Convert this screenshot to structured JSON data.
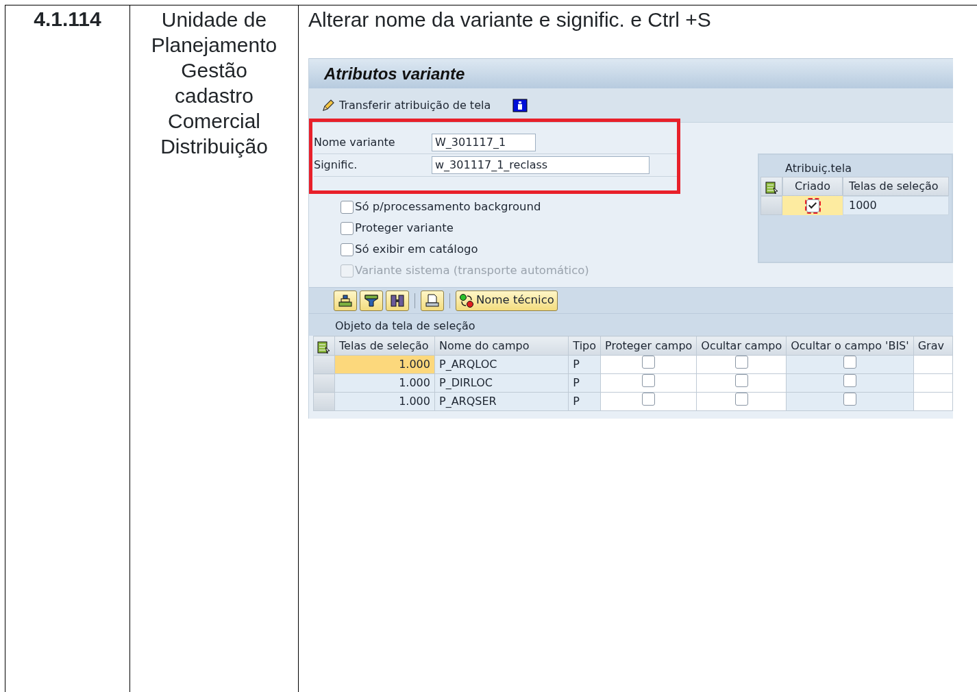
{
  "step": {
    "number": "4.1.114",
    "area": "Unidade de\nPlanejamento\nGestão\ncadastro\nComercial\nDistribuição",
    "instruction": "Alterar nome da variante e signific. e Ctrl +S"
  },
  "sap": {
    "title": "Atributos variante",
    "toolbar": {
      "label": "Transferir atribuição de tela"
    },
    "fields": [
      {
        "label": "Nome variante",
        "value": "W_301117_1"
      },
      {
        "label": "Signific.",
        "value": "w_301117_1_reclass"
      }
    ],
    "options": [
      {
        "label": "Só p/processamento background",
        "checked": false,
        "disabled": false
      },
      {
        "label": "Proteger variante",
        "checked": false,
        "disabled": false
      },
      {
        "label": "Só exibir em catálogo",
        "checked": false,
        "disabled": false
      },
      {
        "label": "Variante sistema (transporte automático)",
        "checked": false,
        "disabled": true
      }
    ],
    "assignment": {
      "title": "Atribuiç.tela",
      "columns": [
        "Criado",
        "Telas de seleção"
      ],
      "rows": [
        {
          "created": true,
          "screen": "1000",
          "selected": true
        }
      ]
    },
    "grid_toolbar": {
      "tech_button": "Nome técnico"
    },
    "section_title": "Objeto da tela de seleção",
    "table": {
      "columns": [
        "Telas de seleção",
        "Nome do campo",
        "Tipo",
        "Proteger campo",
        "Ocultar campo",
        "Ocultar o campo 'BIS'",
        "Grav"
      ],
      "rows": [
        {
          "screen": "1.000",
          "field": "P_ARQLOC",
          "type": "P",
          "protect": false,
          "hide": false,
          "hide_bis": false,
          "selected": true
        },
        {
          "screen": "1.000",
          "field": "P_DIRLOC",
          "type": "P",
          "protect": false,
          "hide": false,
          "hide_bis": false,
          "selected": false
        },
        {
          "screen": "1.000",
          "field": "P_ARQSER",
          "type": "P",
          "protect": false,
          "hide": false,
          "hide_bis": false,
          "selected": false
        }
      ]
    }
  }
}
